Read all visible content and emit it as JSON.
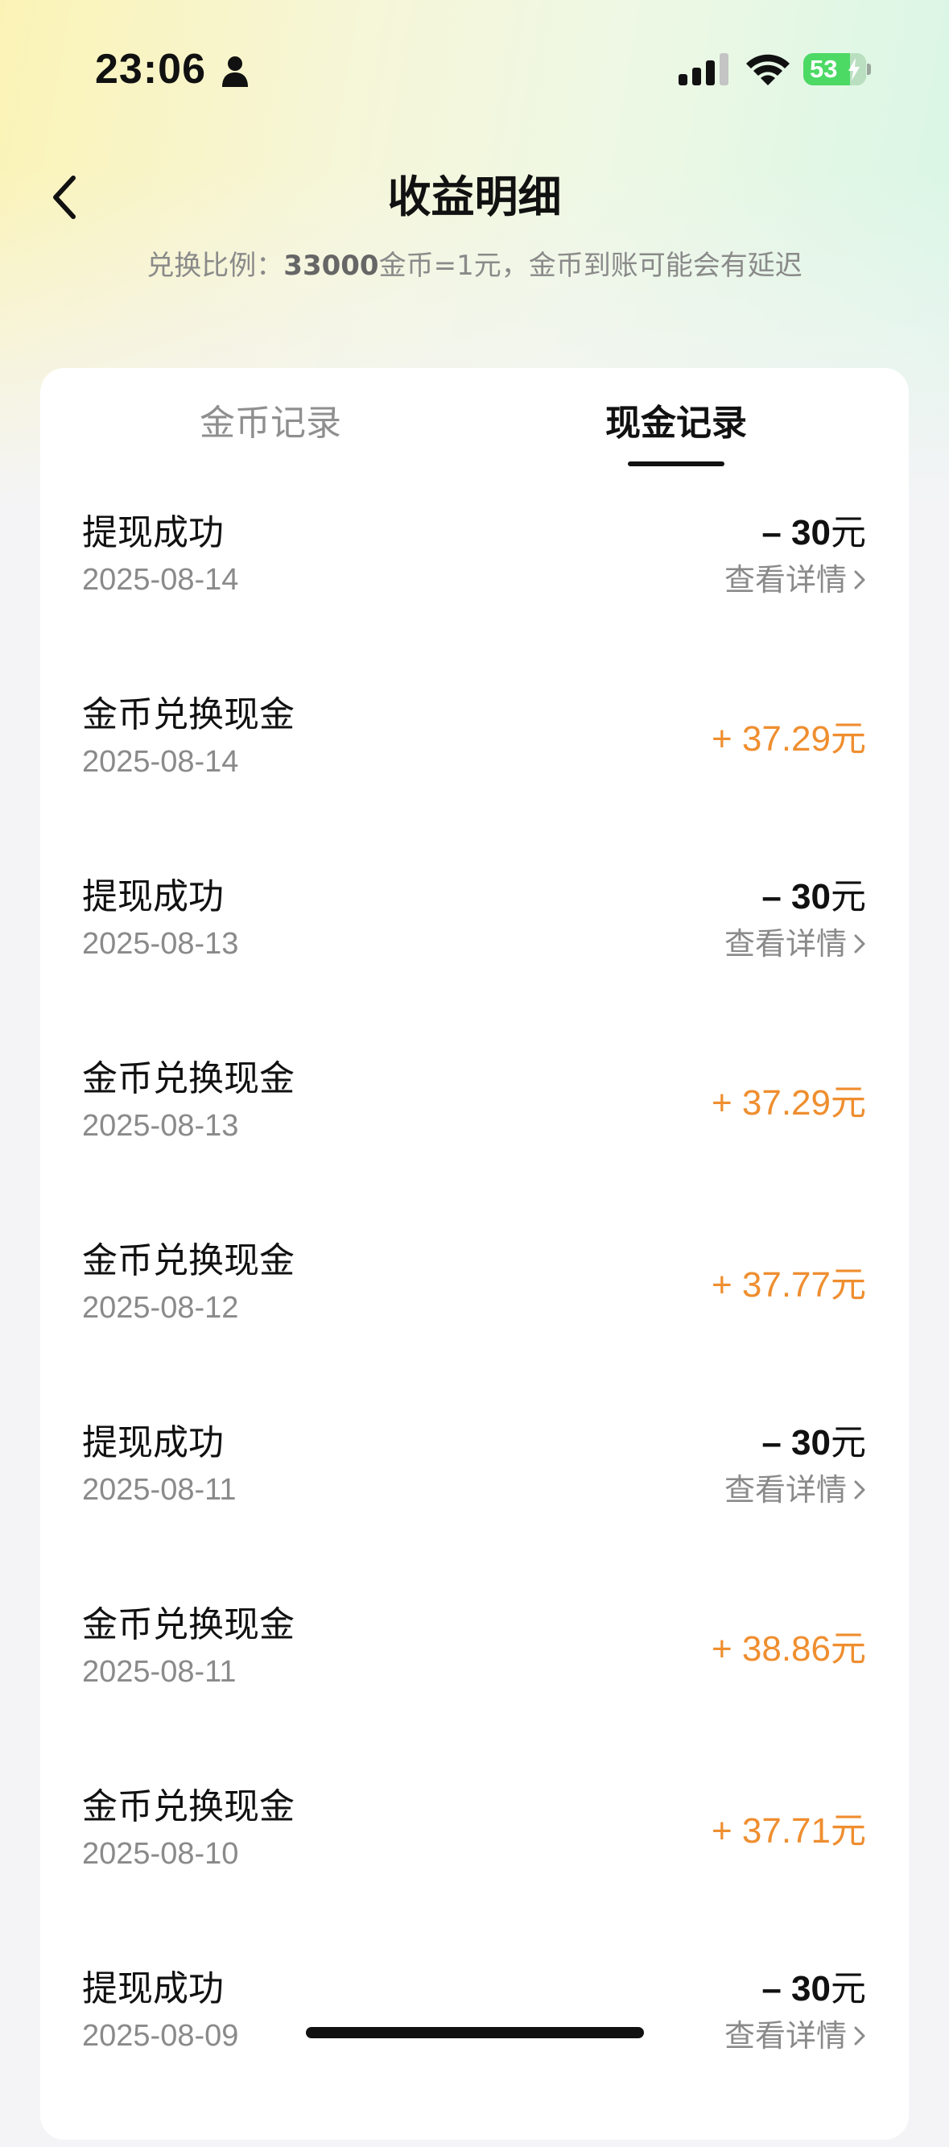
{
  "status_bar": {
    "time": "23:06",
    "battery_level": "53"
  },
  "header": {
    "title": "收益明细",
    "subtitle_prefix": "兑换比例：",
    "subtitle_ratio": "33000",
    "subtitle_suffix": "金币=1元，金币到账可能会有延迟"
  },
  "tabs": [
    {
      "label": "金币记录",
      "active": false
    },
    {
      "label": "现金记录",
      "active": true
    }
  ],
  "records": [
    {
      "title": "提现成功",
      "date": "2025-08-14",
      "amount": "– 30",
      "unit": "元",
      "detail_label": "查看详情"
    },
    {
      "title": "金币兑换现金",
      "date": "2025-08-14",
      "amount": "+ 37.29",
      "unit": "元"
    },
    {
      "title": "提现成功",
      "date": "2025-08-13",
      "amount": "– 30",
      "unit": "元",
      "detail_label": "查看详情"
    },
    {
      "title": "金币兑换现金",
      "date": "2025-08-13",
      "amount": "+ 37.29",
      "unit": "元"
    },
    {
      "title": "金币兑换现金",
      "date": "2025-08-12",
      "amount": "+ 37.77",
      "unit": "元"
    },
    {
      "title": "提现成功",
      "date": "2025-08-11",
      "amount": "– 30",
      "unit": "元",
      "detail_label": "查看详情"
    },
    {
      "title": "金币兑换现金",
      "date": "2025-08-11",
      "amount": "+ 38.86",
      "unit": "元"
    },
    {
      "title": "金币兑换现金",
      "date": "2025-08-10",
      "amount": "+ 37.71",
      "unit": "元"
    },
    {
      "title": "提现成功",
      "date": "2025-08-09",
      "amount": "– 30",
      "unit": "元",
      "detail_label": "查看详情"
    }
  ],
  "colors": {
    "positive_amount": "#ef8e2f",
    "negative_amount": "#111111",
    "battery": "#4cd964"
  },
  "icons": {
    "back": "chevron-left-icon",
    "detail": "chevron-right-icon",
    "person": "person-icon",
    "signal": "cellular-signal-icon",
    "wifi": "wifi-icon",
    "battery": "battery-charging-icon"
  }
}
